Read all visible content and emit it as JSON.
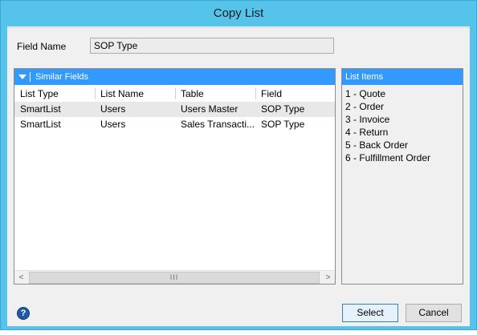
{
  "window": {
    "title": "Copy List"
  },
  "field": {
    "label": "Field Name",
    "value": "SOP Type"
  },
  "similar_fields": {
    "header": "Similar Fields",
    "columns": [
      "List Type",
      "List Name",
      "Table",
      "Field"
    ],
    "rows": [
      [
        "SmartList",
        "Users",
        "Users Master",
        "SOP Type"
      ],
      [
        "SmartList",
        "Users",
        "Sales Transacti...",
        "SOP Type"
      ]
    ],
    "scrollbar": {
      "left_arrow": "<",
      "thumb": "III",
      "right_arrow": ">"
    }
  },
  "list_items": {
    "header": "List Items",
    "items": [
      "1 - Quote",
      "2 - Order",
      "3 - Invoice",
      "4 - Return",
      "5 - Back Order",
      "6 - Fulfillment Order"
    ]
  },
  "footer": {
    "help_icon": "?",
    "select_label": "Select",
    "cancel_label": "Cancel"
  },
  "colors": {
    "title_bar": "#56c4ea",
    "panel_header": "#3399ff",
    "alt_row": "#e8e8e8"
  }
}
